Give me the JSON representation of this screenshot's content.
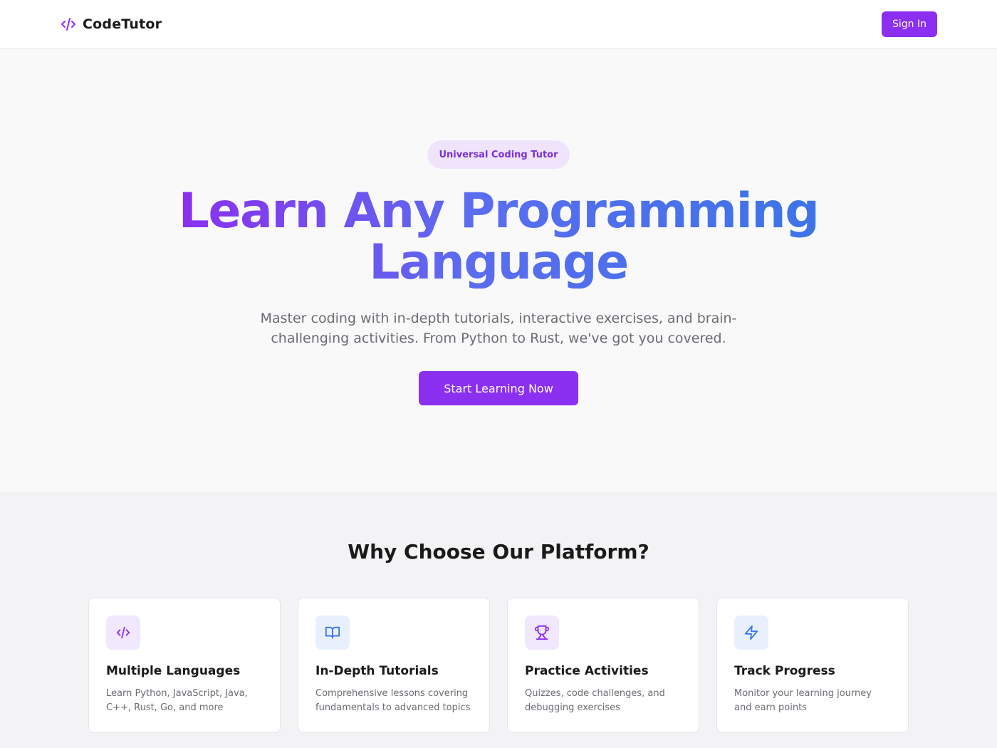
{
  "navbar": {
    "brand_icon": "code-icon",
    "brand_name": "CodeTutor",
    "signin_label": "Sign In"
  },
  "hero": {
    "badge": "Universal Coding Tutor",
    "title": "Learn Any Programming Language",
    "subtitle": "Master coding with in-depth tutorials, interactive exercises, and brain-challenging activities. From Python to Rust, we've got you covered.",
    "cta_label": "Start Learning Now"
  },
  "features": {
    "title": "Why Choose Our Platform?",
    "cards": [
      {
        "icon": "code-icon",
        "title": "Multiple Languages",
        "desc": "Learn Python, JavaScript, Java, C++, Rust, Go, and more"
      },
      {
        "icon": "book-icon",
        "title": "In-Depth Tutorials",
        "desc": "Comprehensive lessons covering fundamentals to advanced topics"
      },
      {
        "icon": "trophy-icon",
        "title": "Practice Activities",
        "desc": "Quizzes, code challenges, and debugging exercises"
      },
      {
        "icon": "lightning-icon",
        "title": "Track Progress",
        "desc": "Monitor your learning journey and earn points"
      }
    ]
  },
  "colors": {
    "accent": "#8b2ff0",
    "accent_blue": "#3d74e8",
    "badge_bg": "#efe4fc",
    "text_muted": "#6b6b72"
  }
}
